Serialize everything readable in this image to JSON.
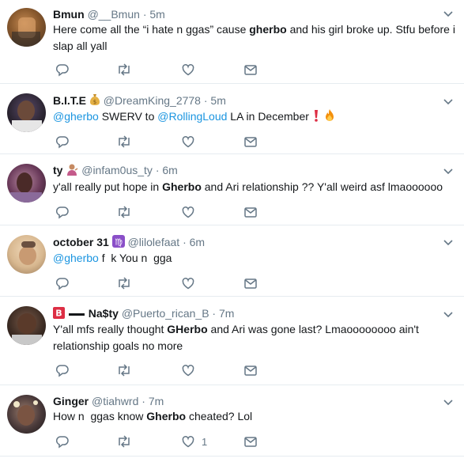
{
  "colors": {
    "name": "#14171a",
    "muted": "#657786",
    "link": "#1b95e0",
    "divider": "#e6ecf0"
  },
  "tweets": [
    {
      "name": "Bmun",
      "handle": "@__Bmun",
      "sep": "·",
      "time": "5m",
      "parts": [
        {
          "t": "Here come all the “i hate n ggas” cause "
        },
        {
          "t": "gherbo",
          "b": true
        },
        {
          "t": " and his girl broke up. Stfu before i slap all yall"
        }
      ],
      "reply_icon": "reply-icon",
      "retweet_icon": "retweet-icon",
      "like_icon": "heart-icon",
      "dm_icon": "envelope-icon"
    },
    {
      "name": "B.I.T.E",
      "name_emoji": "money-bag-icon",
      "handle": "@DreamKing_2778",
      "sep": "·",
      "time": "5m",
      "parts": [
        {
          "t": "@gherbo",
          "link": true
        },
        {
          "t": " SWERV to "
        },
        {
          "t": "@RollingLoud",
          "link": true
        },
        {
          "t": " LA in December "
        }
      ],
      "trailing_icons": [
        "exclamation-icon",
        "fire-icon"
      ]
    },
    {
      "name": "ty",
      "name_emoji": "person-tipping-hand-icon",
      "handle": "@infam0us_ty",
      "sep": "·",
      "time": "6m",
      "parts": [
        {
          "t": "y'all really put hope in "
        },
        {
          "t": "Gherbo",
          "b": true
        },
        {
          "t": " and Ari relationship ?? Y'all weird asf lmaoooooo"
        }
      ]
    },
    {
      "name": "october 31",
      "name_emoji": "virgo-sign-icon",
      "handle": "@lilolefaat",
      "sep": "·",
      "time": "6m",
      "parts": [
        {
          "t": "@gherbo",
          "link": true
        },
        {
          "t": " f  k You n  gga"
        }
      ]
    },
    {
      "name": "Na$ty",
      "name_emoji": "b-button-icon",
      "handle": "@Puerto_rican_B",
      "sep": "·",
      "time": "7m",
      "parts": [
        {
          "t": "Y'all mfs really thought "
        },
        {
          "t": "GHerbo",
          "b": true
        },
        {
          "t": " and Ari was gone last? Lmaoooooooo ain't relationship goals no more"
        }
      ]
    },
    {
      "name": "Ginger",
      "handle": "@tiahwrd",
      "sep": "·",
      "time": "7m",
      "parts": [
        {
          "t": "How n  ggas know "
        },
        {
          "t": "Gherbo",
          "b": true
        },
        {
          "t": " cheated? Lol"
        }
      ],
      "like_count": "1"
    }
  ]
}
